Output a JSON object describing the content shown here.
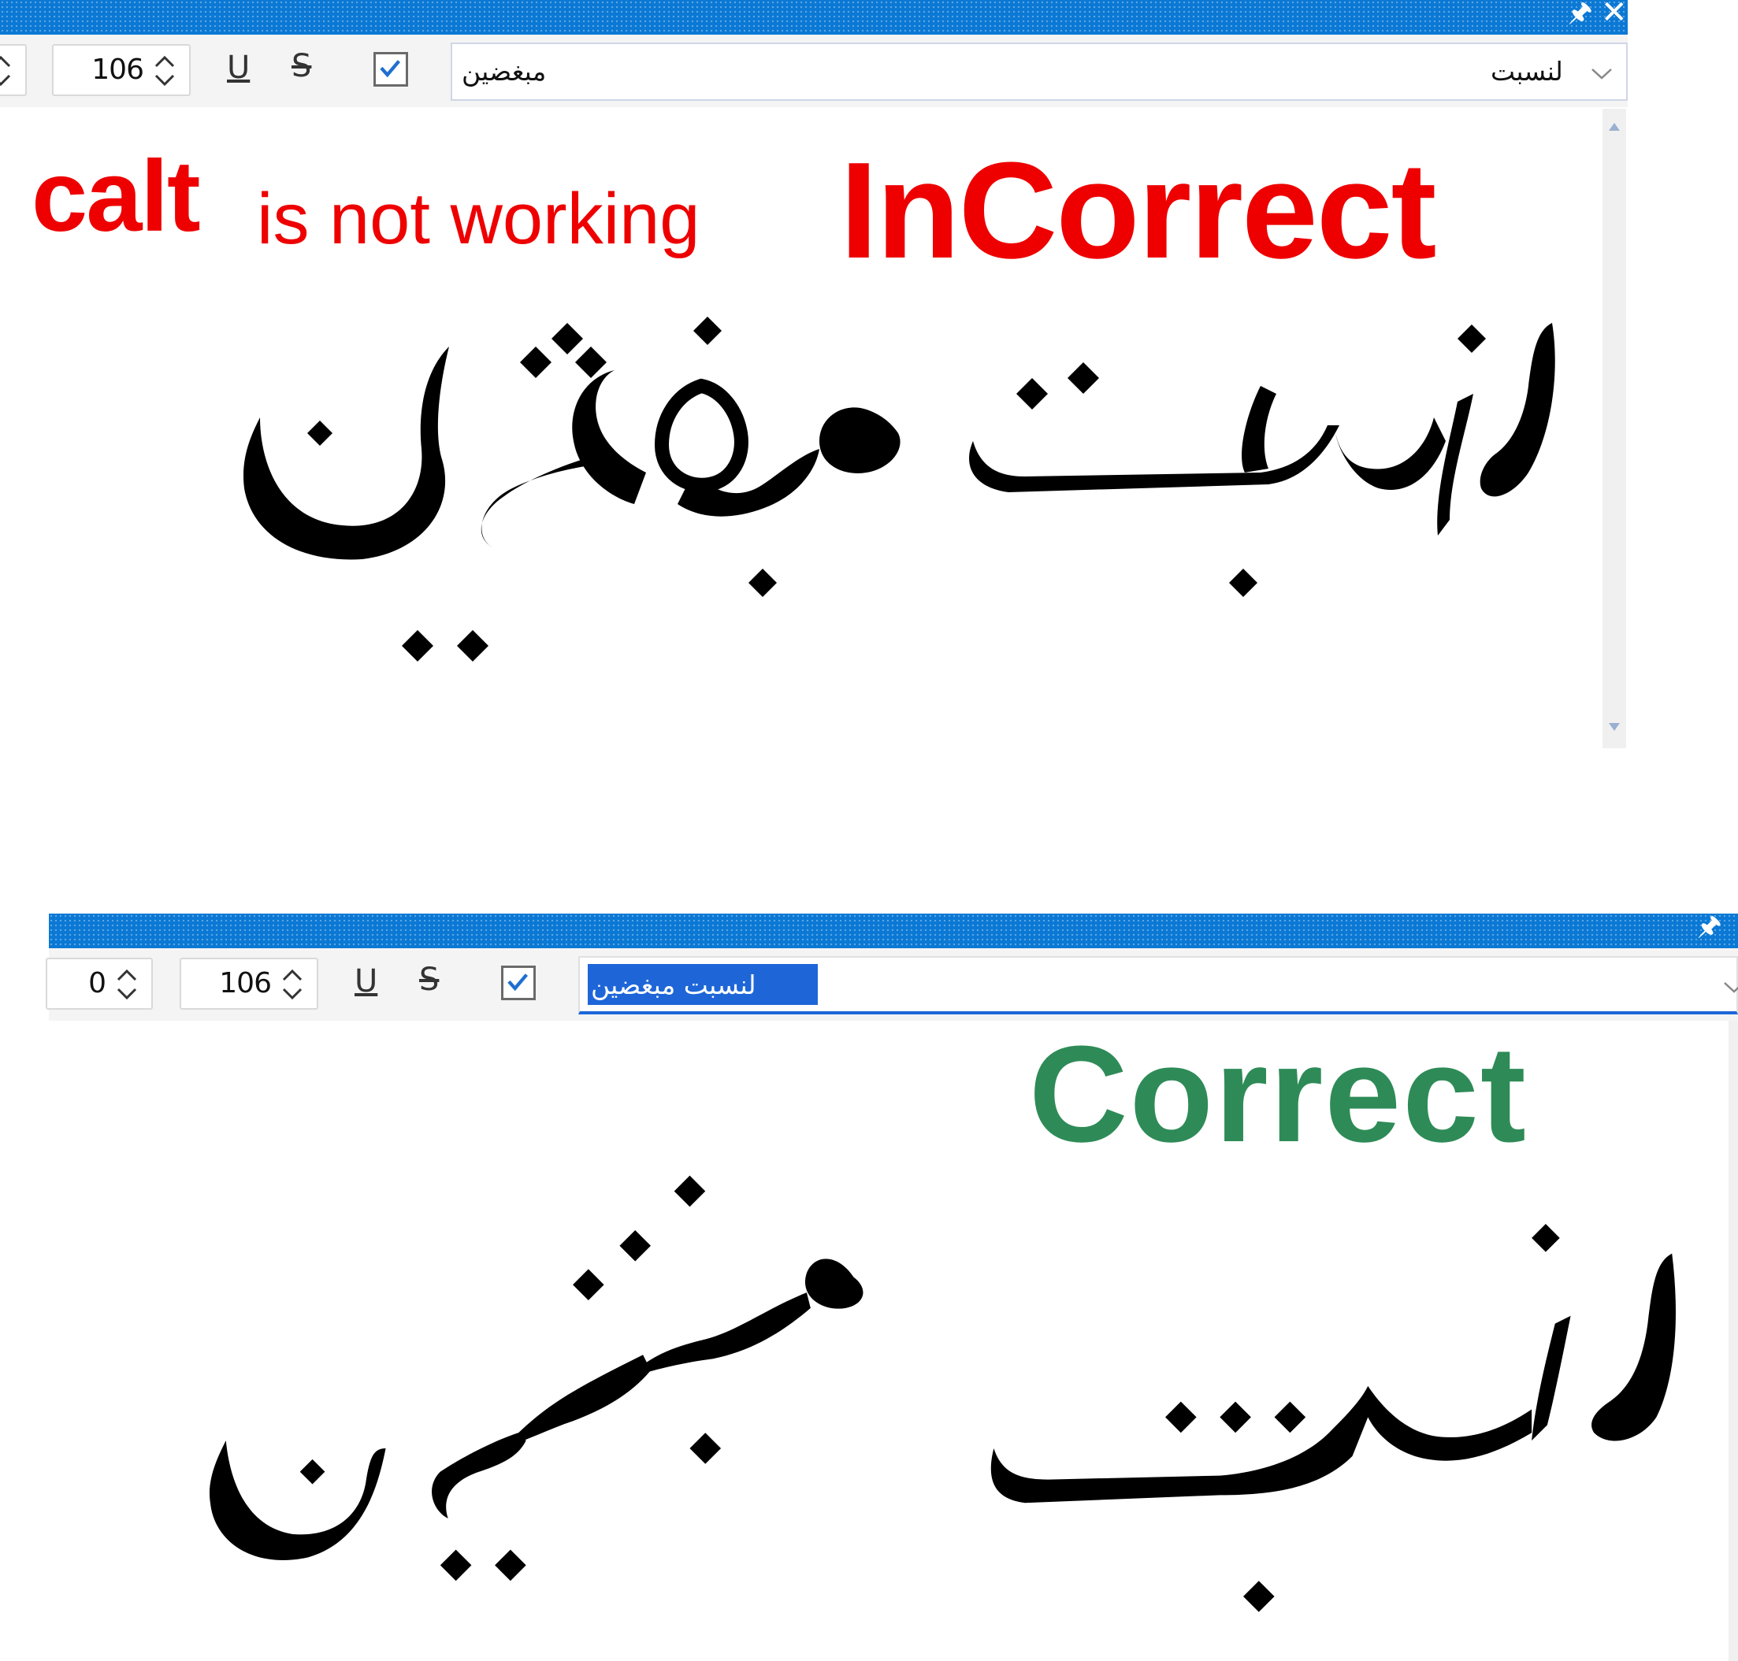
{
  "top_panel": {
    "size_value": "106",
    "underline_label": "U",
    "strike_label": "S",
    "preview_word_left": "مبغضين",
    "preview_word_right": "لنسبت",
    "annotation_calt": "calt",
    "annotation_rest": "is not working",
    "verdict": "InCorrect"
  },
  "bottom_panel": {
    "offset_value": "0",
    "size_value": "106",
    "underline_label": "U",
    "strike_label": "S",
    "preview_text": "لنسبت   مبغضين",
    "verdict": "Correct"
  },
  "colors": {
    "titlebar": "#0a78d4",
    "incorrect": "#ee0000",
    "correct": "#2e8b57",
    "selection": "#1e66d8"
  },
  "icons": {
    "pin": "pin-icon",
    "close": "close-icon",
    "spin": "spin-arrows-icon",
    "check": "checkbox-icon",
    "dropdown": "chevron-down-icon"
  }
}
